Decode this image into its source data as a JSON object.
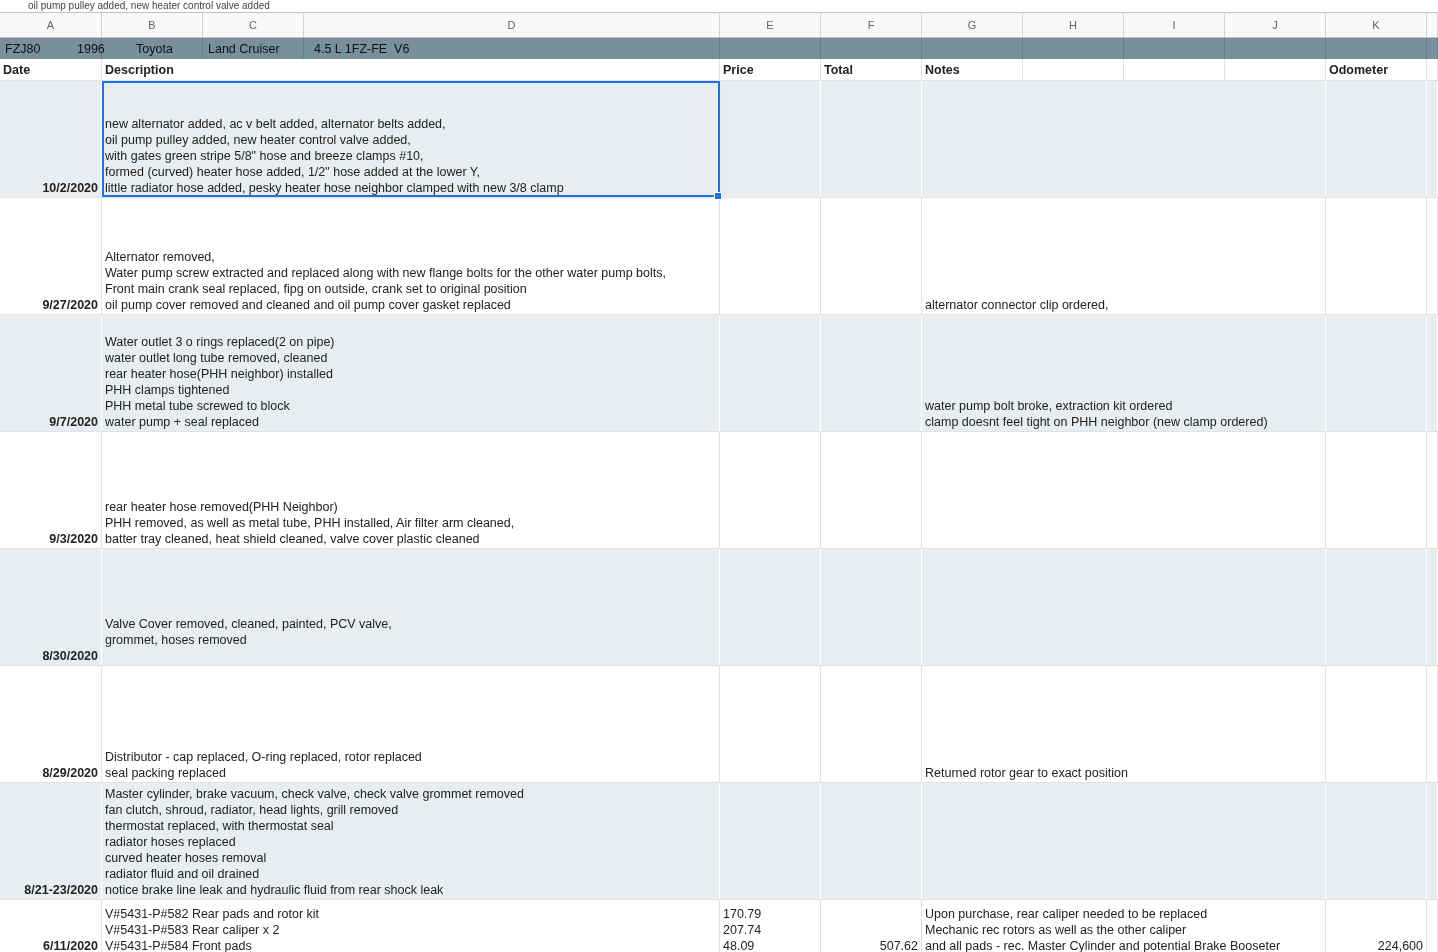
{
  "formula_bar_fragment": "oil pump pulley added, new heater control valve added",
  "column_headers": [
    "A",
    "B",
    "C",
    "D",
    "E",
    "F",
    "G",
    "H",
    "I",
    "J",
    "K"
  ],
  "title_band": [
    "FZJ80",
    "1996",
    "Toyota",
    "Land Cruiser",
    "4.5 L 1FZ-FE  V6"
  ],
  "header_row": {
    "date": "Date",
    "description": "Description",
    "price": "Price",
    "total": "Total",
    "notes": "Notes",
    "odometer": "Odometer"
  },
  "rows": [
    {
      "date": "10/2/2020",
      "description": "new alternator added, ac v belt added, alternator belts added,\noil pump pulley added, new heater control valve added,\nwith gates green stripe 5/8\" hose and breeze clamps #10,\nformed (curved) heater hose added, 1/2\" hose added at the lower Y,\nlittle radiator hose added, pesky heater hose neighbor clamped with new 3/8 clamp",
      "selected": true
    },
    {
      "date": "9/27/2020",
      "description": "Alternator removed,\nWater pump screw extracted and replaced along with new flange bolts for the other water pump bolts,\nFront main crank seal replaced, fipg on outside, crank set to original position\noil pump cover removed and cleaned and oil pump cover gasket replaced",
      "notes": "alternator connector clip ordered,",
      "selected": false
    },
    {
      "date": "9/7/2020",
      "description": "Water outlet 3 o rings replaced(2 on pipe)\nwater outlet long tube removed, cleaned\nrear heater hose(PHH neighbor) installed\nPHH clamps tightened\nPHH metal tube screwed to block\nwater pump + seal replaced",
      "notes": "water pump bolt broke, extraction kit ordered\nclamp doesnt feel tight on PHH neighbor (new clamp ordered)",
      "selected": false
    },
    {
      "date": "9/3/2020",
      "description": "rear heater hose removed(PHH Neighbor)\nPHH removed, as well as metal tube, PHH installed, Air filter arm cleaned,\nbatter tray cleaned, heat shield cleaned, valve cover plastic cleaned",
      "selected": false
    },
    {
      "date": "8/30/2020",
      "description": "Valve Cover removed, cleaned, painted, PCV valve,\ngrommet, hoses removed\n ",
      "selected": false
    },
    {
      "date": "8/29/2020",
      "description": "Distributor - cap replaced, O-ring replaced, rotor replaced\nseal packing replaced",
      "notes": "Returned rotor gear to exact position",
      "selected": false
    },
    {
      "date": "8/21-23/2020",
      "description": "Master cylinder, brake vacuum, check valve, check valve grommet removed\nfan clutch, shroud, radiator, head lights, grill removed\nthermostat replaced, with thermostat seal\nradiator hoses replaced\ncurved heater hoses removal\nradiator fluid and oil drained\nnotice brake line leak and hydraulic fluid from rear shock leak",
      "selected": false
    },
    {
      "date": "6/11/2020",
      "description": "V#5431-P#582 Rear pads and rotor kit\nV#5431-P#583 Rear caliper x 2\nV#5431-P#584 Front pads",
      "price": "170.79\n207.74\n48.09",
      "total": "507.62",
      "notes": "Upon purchase, rear caliper needed to be replaced\nMechanic rec rotors as well as the other caliper\nand all pads - rec. Master Cylinder and potential Brake Booseter",
      "odometer": "224,600",
      "selected": false
    }
  ]
}
